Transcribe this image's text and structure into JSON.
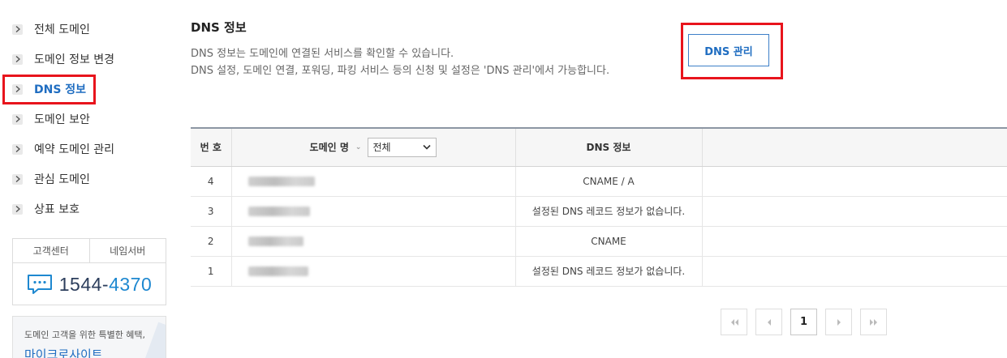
{
  "sidebar": {
    "items": [
      {
        "label": "전체 도메인",
        "active": false
      },
      {
        "label": "도메인 정보 변경",
        "active": false
      },
      {
        "label": "DNS 정보",
        "active": true
      },
      {
        "label": "도메인 보안",
        "active": false
      },
      {
        "label": "예약 도메인 관리",
        "active": false
      },
      {
        "label": "관심 도메인",
        "active": false
      },
      {
        "label": "상표 보호",
        "active": false
      }
    ],
    "support": {
      "tab_customer": "고객센터",
      "tab_nameserver": "네임서버",
      "phone_prefix": "1544-",
      "phone_suffix": "4370"
    },
    "promo": {
      "text": "도메인 고객을 위한 특별한 혜택,",
      "title": "마이크로사이트"
    }
  },
  "main": {
    "title": "DNS 정보",
    "desc_line1": "DNS 정보는 도메인에 연결된 서비스를 확인할 수 있습니다.",
    "desc_line2": "DNS 설정, 도메인 연결, 포워딩, 파킹 서비스 등의 신청 및 설정은 'DNS 관리'에서 가능합니다.",
    "dns_manage_button": "DNS 관리"
  },
  "table": {
    "headers": {
      "number": "번 호",
      "domain": "도메인 명",
      "domain_filter_value": "전체",
      "dns_info": "DNS 정보"
    },
    "rows": [
      {
        "no": "4",
        "dns": "CNAME / A"
      },
      {
        "no": "3",
        "dns": "설정된 DNS 레코드 정보가 없습니다."
      },
      {
        "no": "2",
        "dns": "CNAME"
      },
      {
        "no": "1",
        "dns": "설정된 DNS 레코드 정보가 없습니다."
      }
    ]
  },
  "pagination": {
    "current_page": "1"
  },
  "colors": {
    "accent": "#1f6dc1",
    "highlight": "#e8141c",
    "phone_accent": "#1e88d0"
  }
}
